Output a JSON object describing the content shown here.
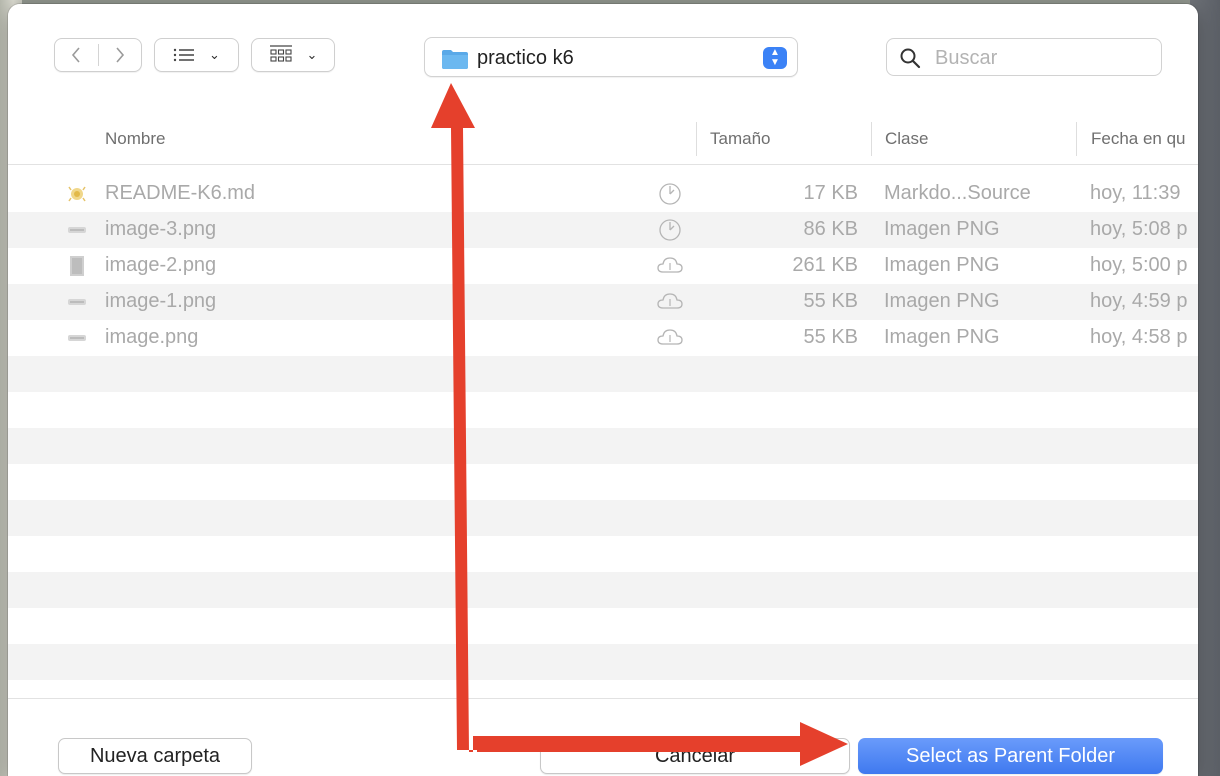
{
  "toolbar": {
    "back_icon": "chevron-left-icon",
    "forward_icon": "chevron-right-icon",
    "list_view_icon": "list-icon",
    "grid_view_icon": "grid-icon",
    "location": {
      "label": "practico k6",
      "icon": "folder-icon",
      "accent": "#3b82f6"
    },
    "search": {
      "placeholder": "Buscar",
      "value": ""
    }
  },
  "columns": {
    "name": "Nombre",
    "size": "Tamaño",
    "kind": "Clase",
    "date": "Fecha en qu"
  },
  "files": [
    {
      "name": "README-K6.md",
      "icon": "markdown-file-icon",
      "status": "clock-icon",
      "size": "17 KB",
      "kind": "Markdo...Source",
      "date": "hoy, 11:39"
    },
    {
      "name": "image-3.png",
      "icon": "image-file-icon",
      "status": "clock-icon",
      "size": "86 KB",
      "kind": "Imagen PNG",
      "date": "hoy, 5:08 p"
    },
    {
      "name": "image-2.png",
      "icon": "image-file-icon",
      "status": "cloud-download-icon",
      "size": "261 KB",
      "kind": "Imagen PNG",
      "date": "hoy, 5:00 p"
    },
    {
      "name": "image-1.png",
      "icon": "image-file-icon",
      "status": "cloud-download-icon",
      "size": "55 KB",
      "kind": "Imagen PNG",
      "date": "hoy, 4:59 p"
    },
    {
      "name": "image.png",
      "icon": "image-file-icon",
      "status": "cloud-download-icon",
      "size": "55 KB",
      "kind": "Imagen PNG",
      "date": "hoy, 4:58 p"
    }
  ],
  "footer": {
    "new_folder": "Nueva carpeta",
    "cancel": "Cancelar",
    "primary": "Select as Parent Folder"
  },
  "annotation": {
    "arrow_color": "#e5402c"
  }
}
